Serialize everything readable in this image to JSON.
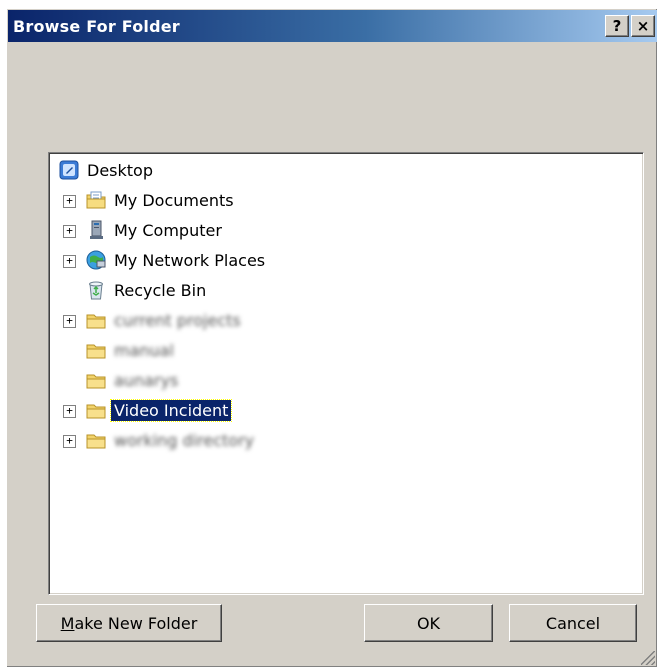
{
  "window": {
    "title": "Browse For Folder",
    "help_label": "?",
    "close_label": "×"
  },
  "tree": {
    "root": {
      "label": "Desktop",
      "icon": "desktop-icon"
    },
    "items": [
      {
        "label": "My Documents",
        "icon": "my-documents-icon",
        "expandable": true
      },
      {
        "label": "My Computer",
        "icon": "my-computer-icon",
        "expandable": true
      },
      {
        "label": "My Network Places",
        "icon": "network-places-icon",
        "expandable": true
      },
      {
        "label": "Recycle Bin",
        "icon": "recycle-bin-icon",
        "expandable": false
      },
      {
        "label": "current projects",
        "icon": "folder-icon",
        "expandable": true,
        "blurred": true
      },
      {
        "label": "manual",
        "icon": "folder-icon",
        "expandable": false,
        "blurred": true
      },
      {
        "label": "aunarys",
        "icon": "folder-icon",
        "expandable": false,
        "blurred": true
      },
      {
        "label": "Video Incident",
        "icon": "folder-icon",
        "expandable": true,
        "selected": true
      },
      {
        "label": "working directory",
        "icon": "folder-icon",
        "expandable": true,
        "blurred": true
      }
    ],
    "expander_symbol": "+"
  },
  "buttons": {
    "make_new_folder_mnemonic": "M",
    "make_new_folder_rest": "ake New Folder",
    "ok": "OK",
    "cancel": "Cancel"
  },
  "colors": {
    "title_gradient_start": "#0a246a",
    "title_gradient_end": "#a6caf0",
    "selection": "#0a246a",
    "dialog_face": "#d4d0c8"
  }
}
